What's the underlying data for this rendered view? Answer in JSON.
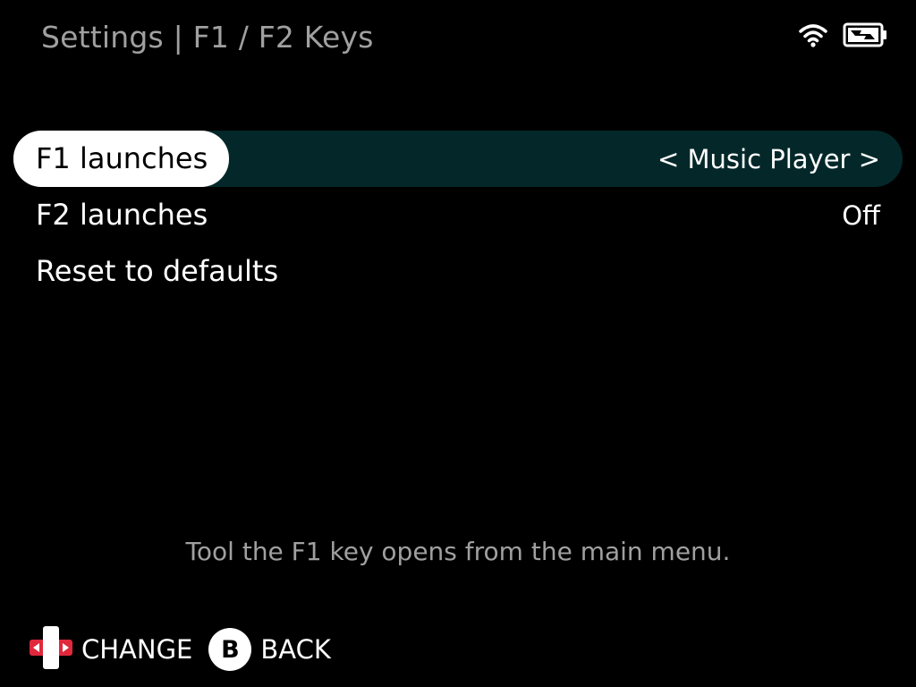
{
  "header": {
    "title": "Settings | F1 / F2 Keys"
  },
  "status": {
    "wifi_icon": "wifi-icon",
    "battery_icon": "battery-charging-icon"
  },
  "menu": {
    "items": [
      {
        "label": "F1 launches",
        "value": "< Music Player >",
        "selected": true
      },
      {
        "label": "F2 launches",
        "value": "Off",
        "selected": false
      },
      {
        "label": "Reset to defaults",
        "value": "",
        "selected": false
      }
    ]
  },
  "hint": {
    "text": "Tool the F1 key opens from the main menu."
  },
  "footer": {
    "change_label": "CHANGE",
    "back_key": "B",
    "back_label": "BACK"
  },
  "colors": {
    "background": "#000000",
    "selected_row_bg": "#042829",
    "selected_label_bg": "#ffffff",
    "dim_text": "#a0a0a0",
    "dpad_accent": "#e0283c"
  }
}
